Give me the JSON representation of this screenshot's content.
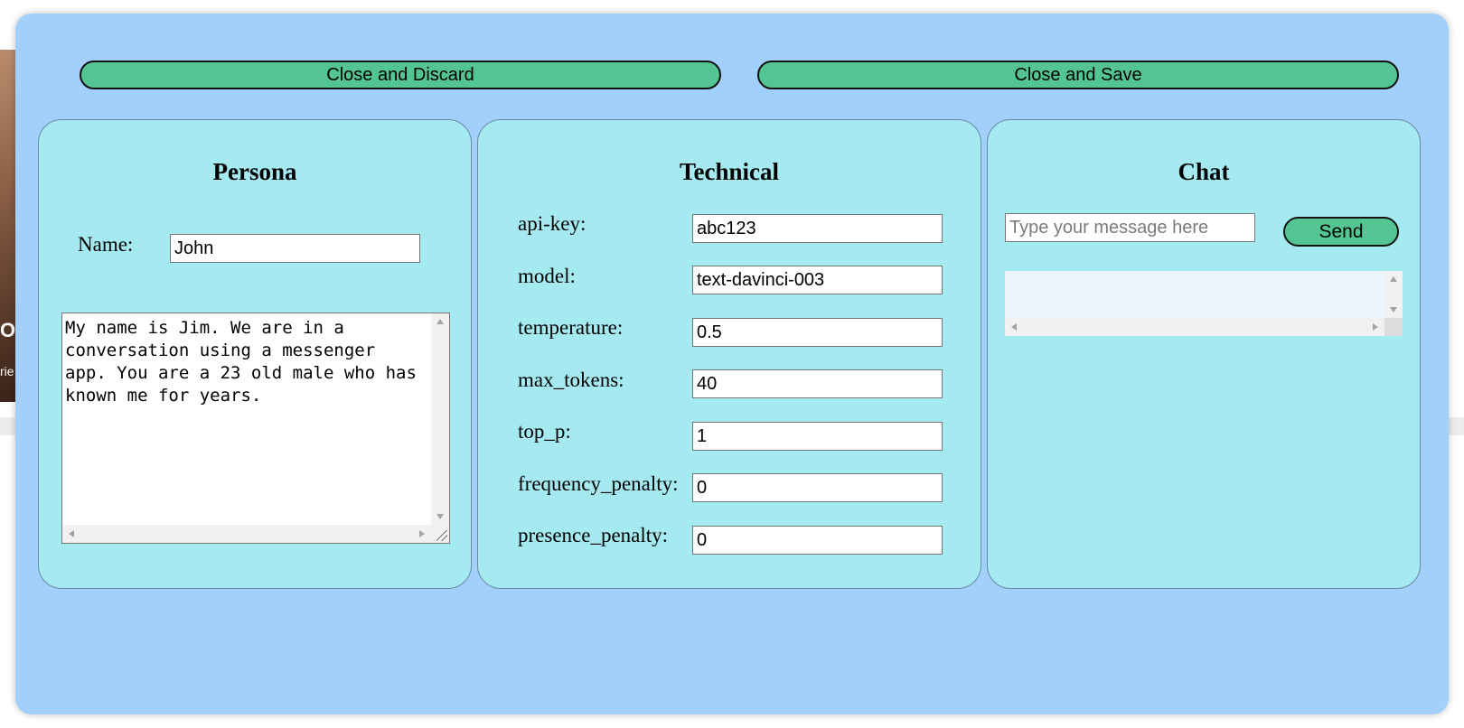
{
  "background": {
    "photo_big_text": "O",
    "photo_small_text": "rie"
  },
  "toolbar": {
    "discard_label": "Close and Discard",
    "save_label": "Close and Save"
  },
  "persona": {
    "title": "Persona",
    "name_label": "Name:",
    "name_value": "John",
    "prompt_text": "My name is Jim. We are in a conversation using a messenger app. You are a 23 old male who has known me for years."
  },
  "technical": {
    "title": "Technical",
    "fields": [
      {
        "label": "api-key:",
        "value": "abc123"
      },
      {
        "label": "model:",
        "value": "text-davinci-003"
      },
      {
        "label": "temperature:",
        "value": "0.5"
      },
      {
        "label": "max_tokens:",
        "value": "40"
      },
      {
        "label": "top_p:",
        "value": "1"
      },
      {
        "label": "frequency_penalty:",
        "value": "0"
      },
      {
        "label": "presence_penalty:",
        "value": "0"
      }
    ]
  },
  "chat": {
    "title": "Chat",
    "message_placeholder": "Type your message here",
    "message_value": "",
    "send_label": "Send",
    "log_text": ""
  },
  "colors": {
    "modal_background": "#a2d0fc",
    "panel_background": "#a4eaf0",
    "button_green": "#52c592"
  }
}
